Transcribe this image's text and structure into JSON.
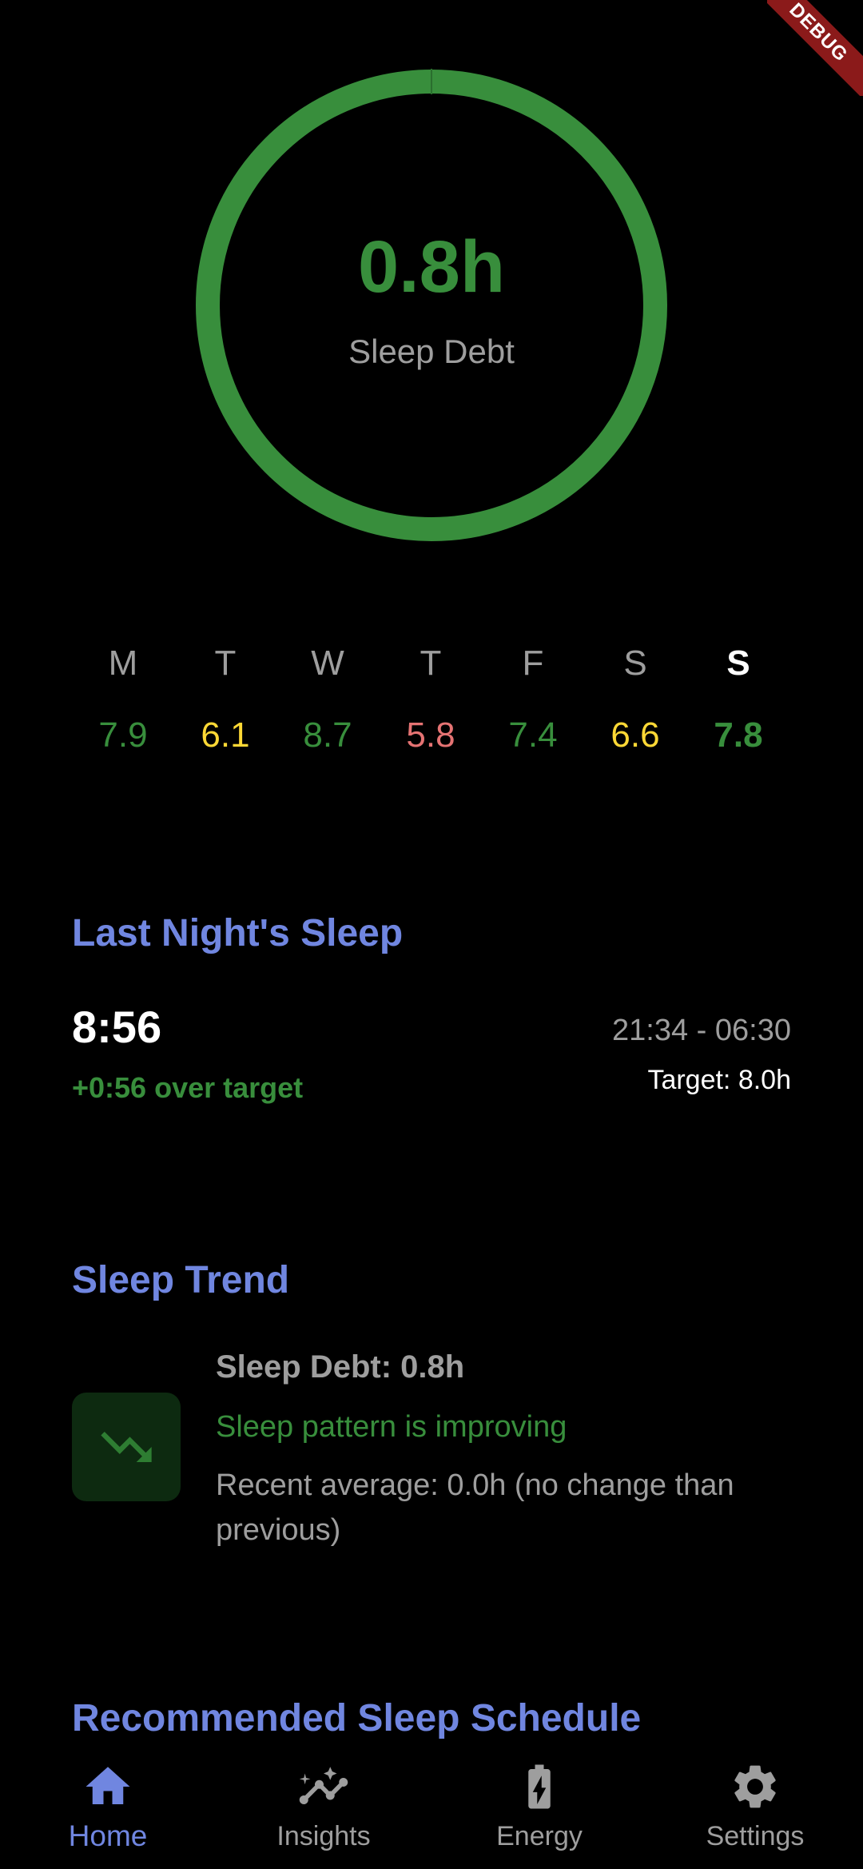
{
  "debug_banner": "DEBUG",
  "sleep_debt": {
    "value": "0.8h",
    "label": "Sleep Debt",
    "ring_color": "#388e3c",
    "ring_fill_fraction": 1.0
  },
  "week": [
    {
      "day": "M",
      "hours": "7.9",
      "color": "#388e3c",
      "today": false
    },
    {
      "day": "T",
      "hours": "6.1",
      "color": "#fdd835",
      "today": false
    },
    {
      "day": "W",
      "hours": "8.7",
      "color": "#388e3c",
      "today": false
    },
    {
      "day": "T",
      "hours": "5.8",
      "color": "#e57373",
      "today": false
    },
    {
      "day": "F",
      "hours": "7.4",
      "color": "#388e3c",
      "today": false
    },
    {
      "day": "S",
      "hours": "6.6",
      "color": "#fdd835",
      "today": false
    },
    {
      "day": "S",
      "hours": "7.8",
      "color": "#388e3c",
      "today": true
    }
  ],
  "last_night": {
    "title": "Last Night's Sleep",
    "duration": "8:56",
    "over_target": "+0:56 over target",
    "time_range": "21:34 - 06:30",
    "target": "Target: 8.0h"
  },
  "sleep_trend": {
    "title": "Sleep Trend",
    "icon": "trending-down-icon",
    "debt": "Sleep Debt: 0.8h",
    "status": "Sleep pattern is improving",
    "average": "Recent average: 0.0h (no change than previous)"
  },
  "schedule": {
    "title": "Recommended Sleep Schedule"
  },
  "nav": [
    {
      "label": "Home",
      "icon": "home-icon",
      "active": true
    },
    {
      "label": "Insights",
      "icon": "insights-icon",
      "active": false
    },
    {
      "label": "Energy",
      "icon": "battery-charging-icon",
      "active": false
    },
    {
      "label": "Settings",
      "icon": "gear-icon",
      "active": false
    }
  ],
  "colors": {
    "accent": "#7086e0",
    "good": "#388e3c",
    "warning": "#fdd835",
    "bad": "#e57373",
    "muted": "#9e9e9e",
    "background": "#000000"
  }
}
